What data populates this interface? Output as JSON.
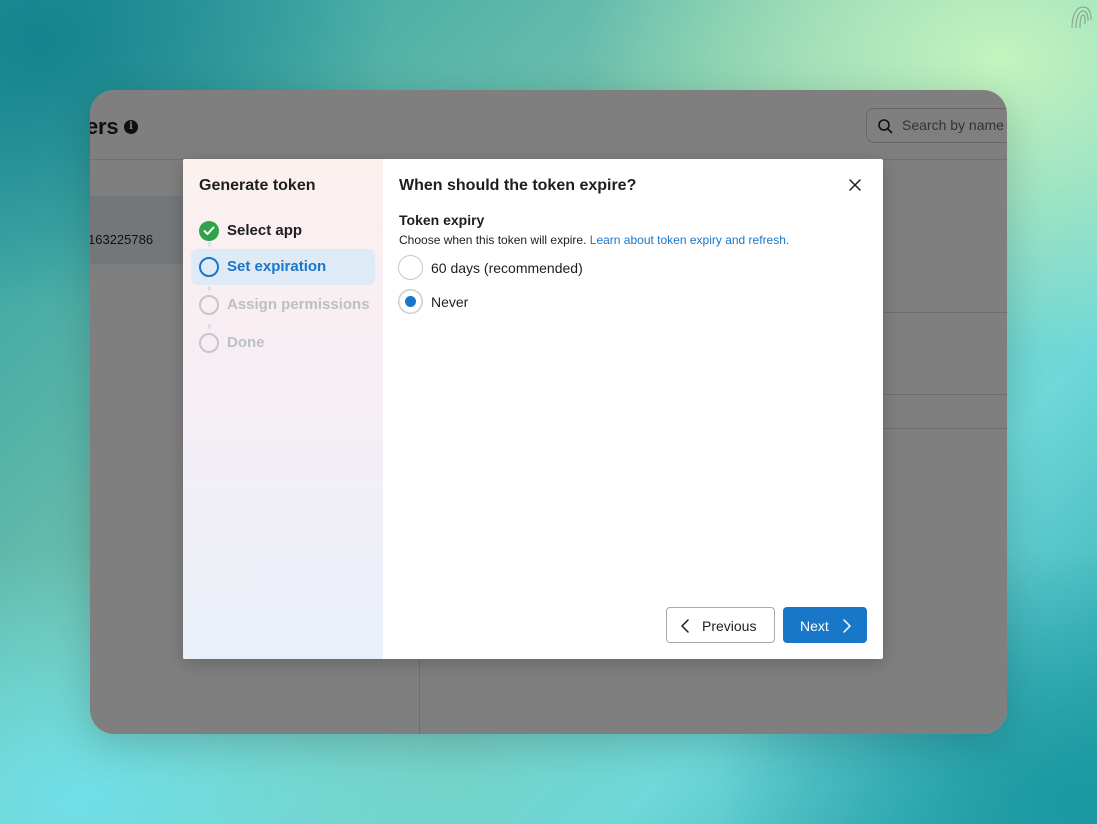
{
  "background_window": {
    "title": "ers",
    "info_icon": "info-icon",
    "search": {
      "placeholder": "Search by name"
    },
    "selected_row_id": "163225786"
  },
  "modal": {
    "stepper": {
      "title": "Generate token",
      "steps": [
        {
          "label": "Select app",
          "state": "done"
        },
        {
          "label": "Set expiration",
          "state": "active"
        },
        {
          "label": "Assign permissions",
          "state": "todo"
        },
        {
          "label": "Done",
          "state": "todo"
        }
      ]
    },
    "title": "When should the token expire?",
    "section": {
      "title": "Token expiry",
      "description": "Choose when this token will expire.",
      "link": "Learn about token expiry and refresh."
    },
    "options": [
      {
        "label": "60 days (recommended)",
        "checked": false
      },
      {
        "label": "Never",
        "checked": true
      }
    ],
    "buttons": {
      "previous": "Previous",
      "next": "Next"
    }
  },
  "colors": {
    "accent": "#1877c9",
    "success": "#31a24c",
    "disabled_text": "#bcc0c4"
  }
}
